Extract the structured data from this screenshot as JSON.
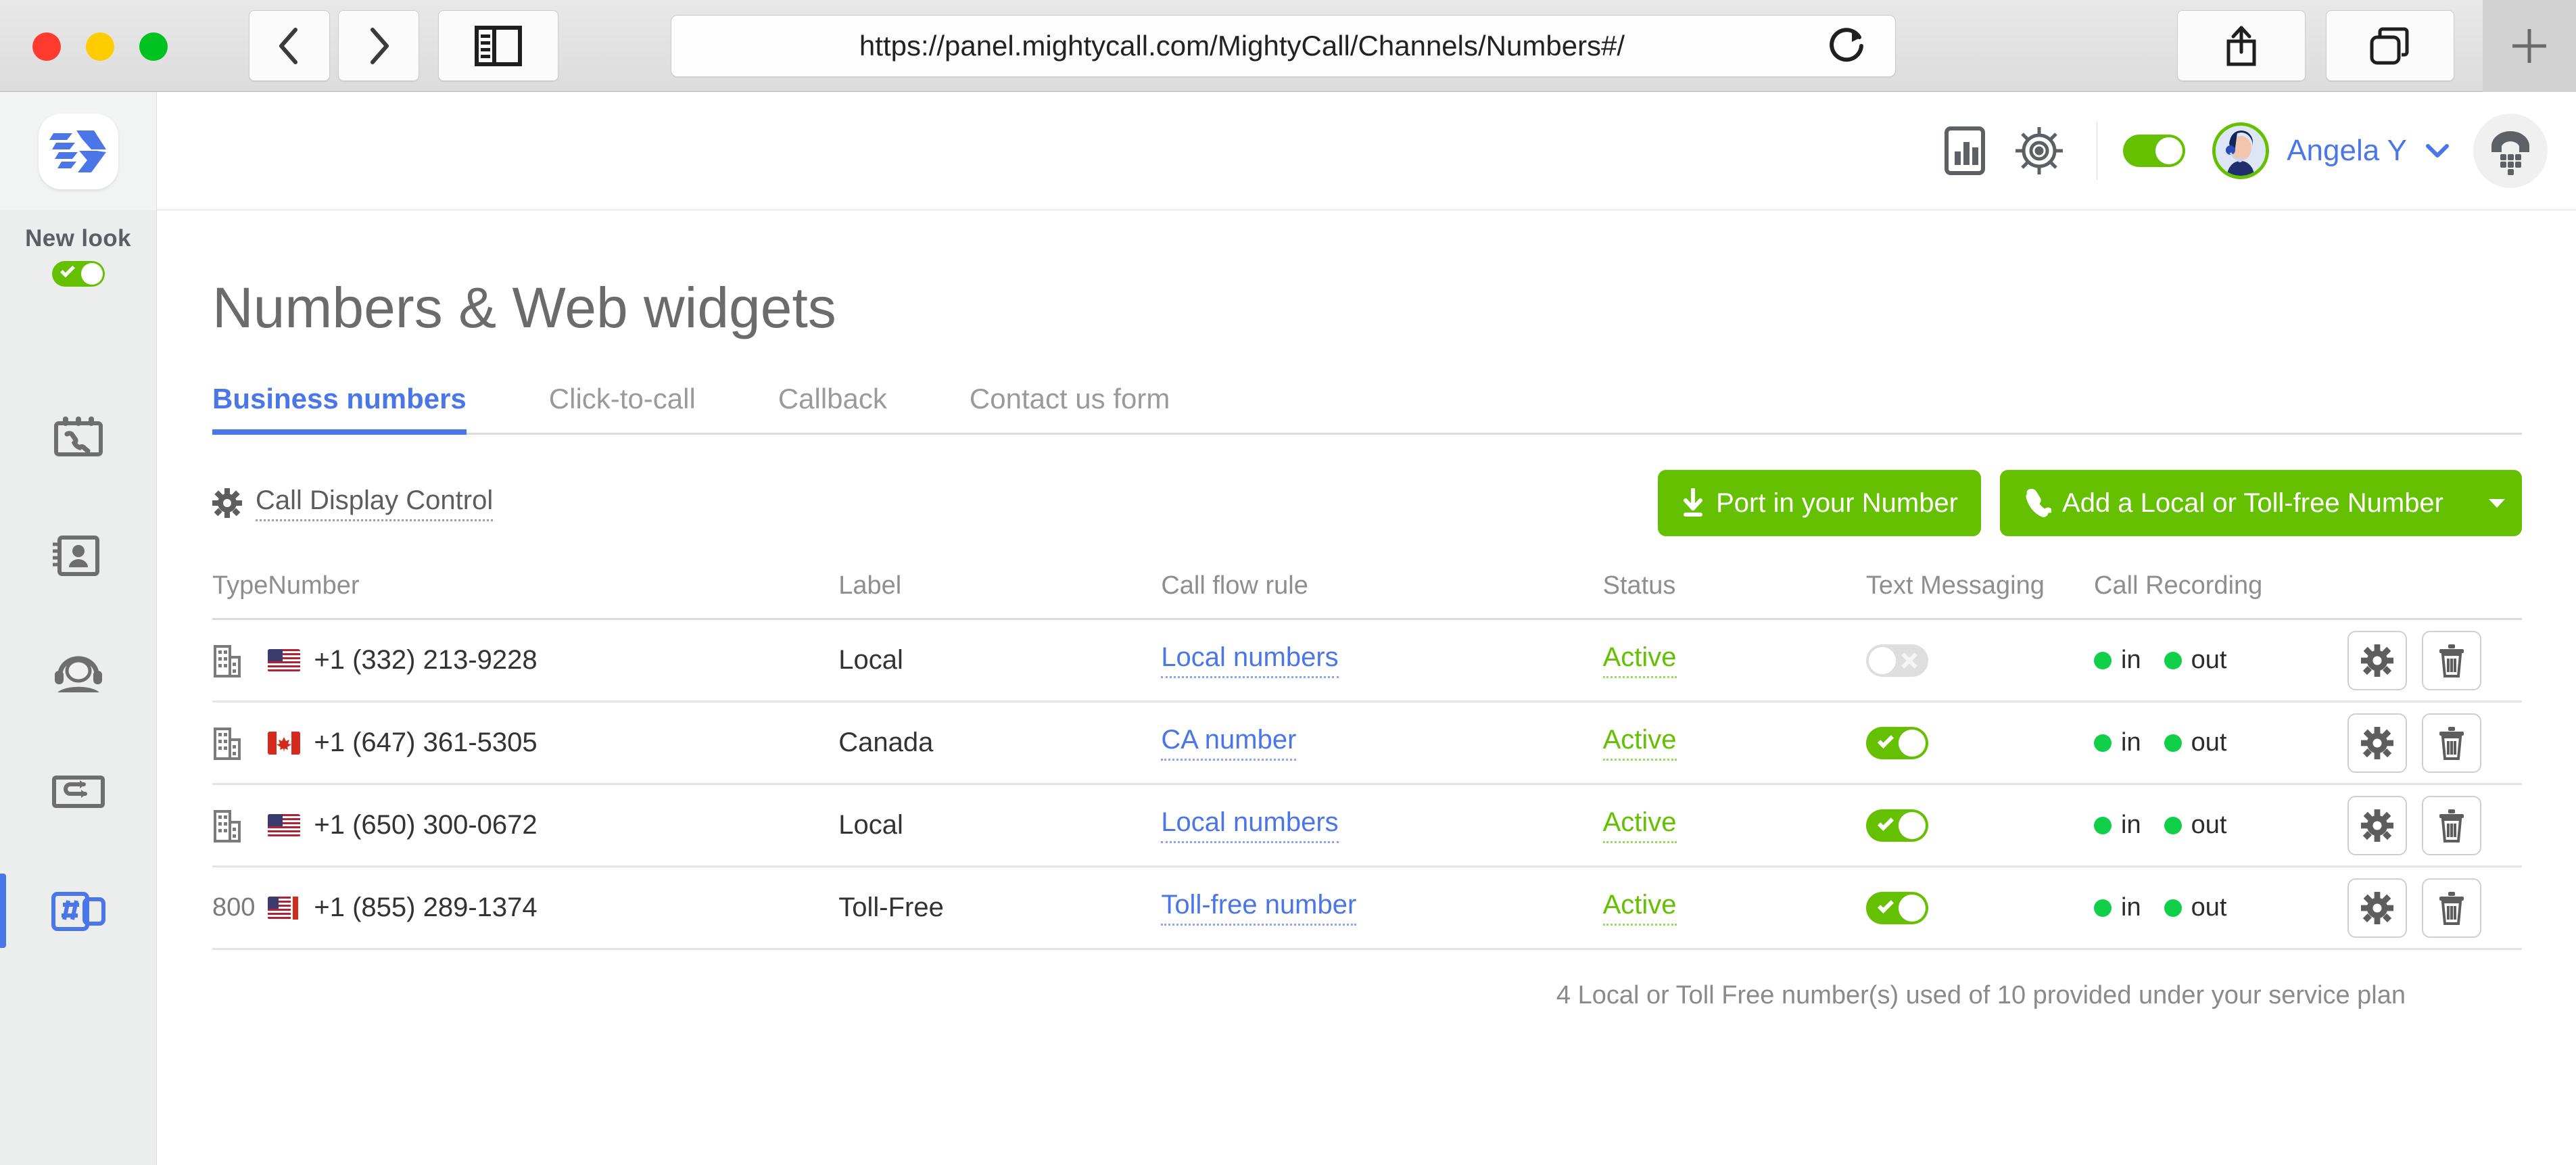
{
  "browser": {
    "url": "https://panel.mightycall.com/MightyCall/Channels/Numbers#/",
    "back_icon": "chevron-left-icon",
    "forward_icon": "chevron-right-icon",
    "sidebar_icon": "sidebar-toggle-icon",
    "reload_icon": "reload-icon",
    "share_icon": "share-icon",
    "tabs_icon": "tabs-overview-icon",
    "newtab_icon": "plus-icon"
  },
  "sidebar": {
    "logo_name": "mightycall-logo",
    "newlook_label": "New look",
    "newlook_enabled": true,
    "items": [
      {
        "name": "sidebar-item-call-history",
        "icon": "call-history-icon",
        "active": false
      },
      {
        "name": "sidebar-item-contacts",
        "icon": "contacts-icon",
        "active": false
      },
      {
        "name": "sidebar-item-agents",
        "icon": "agent-headset-icon",
        "active": false
      },
      {
        "name": "sidebar-item-call-flow",
        "icon": "call-flow-icon",
        "active": false
      },
      {
        "name": "sidebar-item-numbers",
        "icon": "numbers-hash-icon",
        "active": true
      }
    ]
  },
  "topbar": {
    "stats_icon": "bar-chart-icon",
    "settings_icon": "gear-icon",
    "availability_enabled": true,
    "user_name": "Angela Y",
    "avatar_icon": "user-avatar",
    "caret_icon": "chevron-down-icon",
    "dialpad_icon": "dialpad-icon"
  },
  "page": {
    "title": "Numbers & Web widgets",
    "tabs": [
      {
        "label": "Business numbers",
        "active": true
      },
      {
        "label": "Click-to-call",
        "active": false
      },
      {
        "label": "Callback",
        "active": false
      },
      {
        "label": "Contact us form",
        "active": false
      }
    ],
    "call_display_control": {
      "label": "Call Display Control",
      "icon": "gear-icon"
    },
    "buttons": {
      "port_in": {
        "label": "Port in your Number",
        "icon": "download-icon"
      },
      "add_number": {
        "label": "Add a Local or Toll-free Number",
        "icon": "phone-icon",
        "caret": "caret-down-icon"
      }
    },
    "table": {
      "headers": [
        "Type",
        "Number",
        "Label",
        "Call flow rule",
        "Status",
        "Text Messaging",
        "Call Recording"
      ],
      "rows": [
        {
          "type": "building",
          "type_text": "",
          "flag": "us",
          "number": "+1 (332) 213-9228",
          "label": "Local",
          "call_flow_rule": "Local numbers",
          "status": "Active",
          "text_messaging": false,
          "recording_in": "in",
          "recording_out": "out",
          "settings_icon": "gear-icon",
          "delete_icon": "trash-icon"
        },
        {
          "type": "building",
          "type_text": "",
          "flag": "ca",
          "number": "+1 (647) 361-5305",
          "label": "Canada",
          "call_flow_rule": "CA number",
          "status": "Active",
          "text_messaging": true,
          "recording_in": "in",
          "recording_out": "out",
          "settings_icon": "gear-icon",
          "delete_icon": "trash-icon"
        },
        {
          "type": "building",
          "type_text": "",
          "flag": "us",
          "number": "+1 (650) 300-0672",
          "label": "Local",
          "call_flow_rule": "Local numbers",
          "status": "Active",
          "text_messaging": true,
          "recording_in": "in",
          "recording_out": "out",
          "settings_icon": "gear-icon",
          "delete_icon": "trash-icon"
        },
        {
          "type": "text",
          "type_text": "800",
          "flag": "tollfree",
          "number": "+1 (855) 289-1374",
          "label": "Toll-Free",
          "call_flow_rule": "Toll-free number",
          "status": "Active",
          "text_messaging": true,
          "recording_in": "in",
          "recording_out": "out",
          "settings_icon": "gear-icon",
          "delete_icon": "trash-icon"
        }
      ]
    },
    "footer_note": "4 Local or Toll Free number(s) used of 10 provided under your service plan"
  },
  "colors": {
    "brand_blue": "#4a76e8",
    "accent_green": "#64c000",
    "status_dot_green": "#12cf4a",
    "text_gray": "#6b6b6b",
    "muted_gray": "#8e8e8e"
  }
}
